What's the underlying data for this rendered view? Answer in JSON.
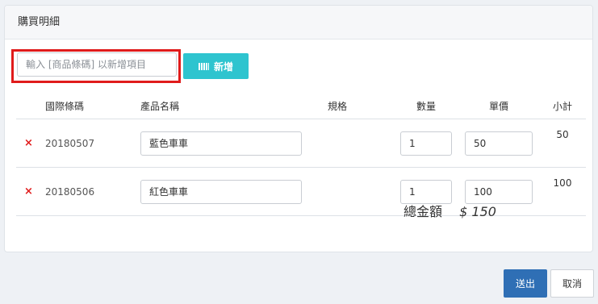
{
  "panel": {
    "title": "購買明細"
  },
  "add_item": {
    "placeholder": "輸入 [商品條碼] 以新增項目",
    "value": "",
    "button_label": "新增",
    "button_icon": "barcode-icon",
    "highlight_color": "#e01b1b"
  },
  "table": {
    "headers": {
      "barcode": "國際條碼",
      "name": "產品名稱",
      "spec": "規格",
      "qty": "數量",
      "price": "單價",
      "subtotal": "小計"
    },
    "rows": [
      {
        "delete_icon": "×",
        "barcode": "20180507",
        "name": "藍色車車",
        "spec": "",
        "qty": "1",
        "price": "50",
        "subtotal": "50"
      },
      {
        "delete_icon": "×",
        "barcode": "20180506",
        "name": "紅色車車",
        "spec": "",
        "qty": "1",
        "price": "100",
        "subtotal": "100"
      }
    ]
  },
  "total": {
    "label": "總金額",
    "value": "$ 150"
  },
  "actions": {
    "submit_label": "送出",
    "cancel_label": "取消"
  },
  "colors": {
    "add_button": "#2ec4cf",
    "submit_button": "#2f6fb5",
    "delete_icon": "#e01b1b"
  }
}
